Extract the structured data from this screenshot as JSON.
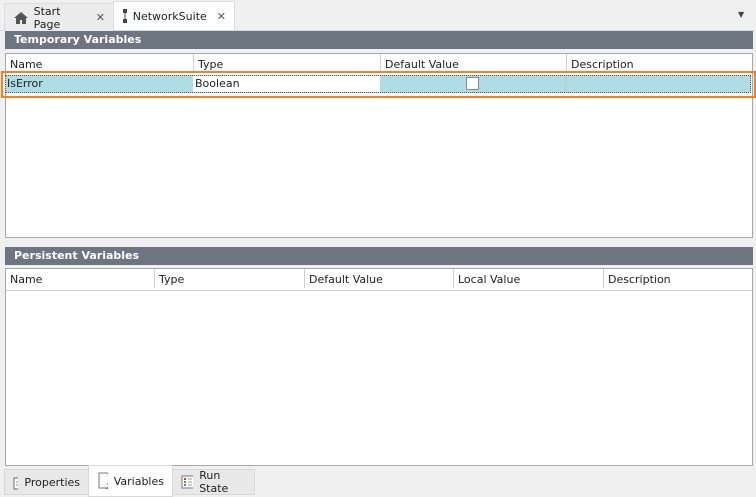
{
  "tabs": [
    {
      "label": "Start Page",
      "icon": "home-icon"
    },
    {
      "label": "NetworkSuite",
      "icon": "network-icon",
      "active": true
    }
  ],
  "close_glyph": "✕",
  "dropdown_glyph": "▼",
  "temporary": {
    "title": "Temporary Variables",
    "columns": [
      "Name",
      "Type",
      "Default Value",
      "Description"
    ],
    "rows": [
      {
        "name": "IsError",
        "type": "Boolean",
        "default_checked": false,
        "description": ""
      }
    ]
  },
  "persistent": {
    "title": "Persistent Variables",
    "columns": [
      "Name",
      "Type",
      "Default Value",
      "Local Value",
      "Description"
    ],
    "rows": []
  },
  "bottom_tabs": [
    {
      "label": "Properties",
      "icon": "properties-icon"
    },
    {
      "label": "Variables",
      "icon": "variables-icon",
      "active": true
    },
    {
      "label": "Run State",
      "icon": "run-state-icon"
    }
  ],
  "accent": "#f58220"
}
